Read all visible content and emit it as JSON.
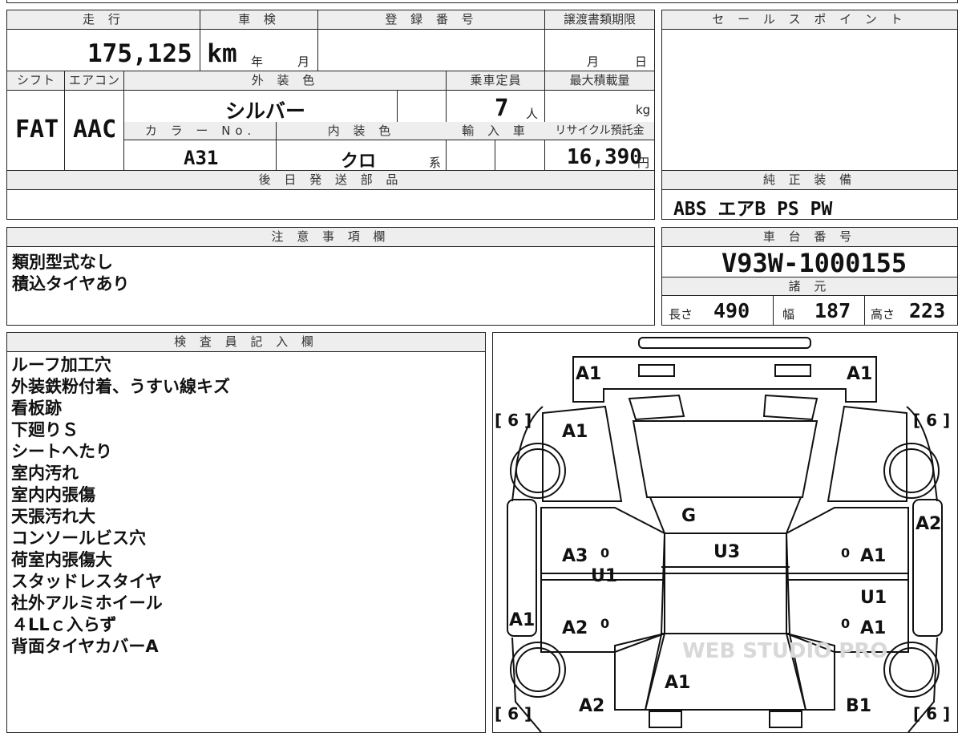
{
  "mileage": {
    "label": "走 行",
    "value": "175,125 km"
  },
  "inspection": {
    "label": "車 検",
    "year_unit": "年",
    "month_unit": "月"
  },
  "registration": {
    "label": "登 録 番 号"
  },
  "transfer": {
    "label": "譲渡書類期限",
    "month_unit": "月",
    "day_unit": "日"
  },
  "shift": {
    "label": "シフト",
    "value": "FAT"
  },
  "aircon": {
    "label": "エアコン",
    "value": "AAC"
  },
  "exterior_color": {
    "label": "外 装 色",
    "value": "シルバー"
  },
  "capacity": {
    "label": "乗車定員",
    "value": "7",
    "unit": "人"
  },
  "max_load": {
    "label": "最大積載量",
    "unit": "kg"
  },
  "color_no": {
    "label": "カ ラ ー No.",
    "value": "A31"
  },
  "interior_color": {
    "label": "内 装 色",
    "value": "クロ",
    "suffix": "系"
  },
  "import": {
    "label": "輸 入 車"
  },
  "recycle": {
    "label": "リサイクル預託金",
    "value": "16,390",
    "unit": "円"
  },
  "later_parts": {
    "label": "後 日 発 送 部 品"
  },
  "sales_point": {
    "label": "セ ー ル ス ポ イ ン ト"
  },
  "equipment": {
    "label": "純 正 装 備",
    "value": "ABS エアB PS PW"
  },
  "caution": {
    "label": "注 意 事 項 欄",
    "lines": [
      "類別型式なし",
      "積込タイヤあり"
    ]
  },
  "chassis": {
    "label": "車 台 番 号",
    "value": "V93W-1000155"
  },
  "dimensions": {
    "label": "諸 元",
    "length_label": "長さ",
    "length": "490",
    "width_label": "幅",
    "width": "187",
    "height_label": "高さ",
    "height": "223"
  },
  "inspector": {
    "label": "検 査 員 記 入 欄",
    "lines": [
      "ルーフ加工穴",
      "外装鉄粉付着、うすい線キズ",
      "看板跡",
      "下廻りＳ",
      "シートへたり",
      "室内汚れ",
      "室内内張傷",
      "天張汚れ大",
      "コンソールビス穴",
      "荷室内張傷大",
      "スタッドレスタイヤ",
      "社外アルミホイール",
      "４LLｃ入らず",
      "背面タイヤカバーA"
    ]
  },
  "diagram": {
    "marks": {
      "front_left": "A1",
      "front_right": "A1",
      "fender_left": "A1",
      "hood": "G",
      "roof": "U3",
      "door_left_front": "A3",
      "door_left_front_inner": "U1",
      "door_left_rear": "A2",
      "side_left": "A1",
      "side_right_top": "A2",
      "door_right_front": "A1",
      "door_right_front_inner": "U1",
      "door_right_rear": "A1",
      "rear_center": "A1",
      "rear_left": "A2",
      "rear_right": "B1"
    },
    "tire_labels": [
      "[ 6 ]",
      "[ 6 ]",
      "[ 6 ]",
      "[ 6 ]"
    ],
    "door_zeros": [
      "0",
      "0",
      "0",
      "0"
    ],
    "watermark": "WEB STUDIO PRO"
  }
}
